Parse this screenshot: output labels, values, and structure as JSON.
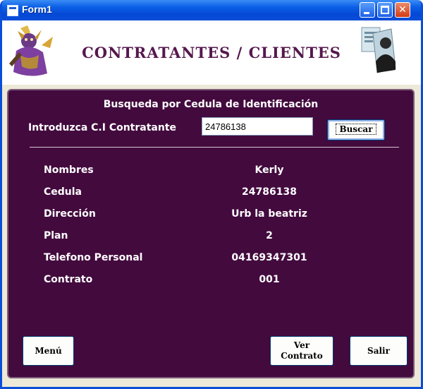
{
  "window": {
    "title": "Form1"
  },
  "header": {
    "title": "CONTRATANTES / CLIENTES"
  },
  "search": {
    "heading": "Busqueda por Cedula de Identificación",
    "label": "Introduzca C.I Contratante",
    "value": "24786138",
    "button": "Buscar"
  },
  "details": [
    {
      "label": "Nombres",
      "value": "Kerly"
    },
    {
      "label": "Cedula",
      "value": "24786138"
    },
    {
      "label": "Dirección",
      "value": "Urb la beatriz"
    },
    {
      "label": "Plan",
      "value": "2"
    },
    {
      "label": "Telefono Personal",
      "value": "04169347301"
    },
    {
      "label": "Contrato",
      "value": "001"
    }
  ],
  "buttons": {
    "menu": "Menú",
    "ver_line1": "Ver",
    "ver_line2": "Contrato",
    "salir": "Salir"
  },
  "colors": {
    "panel": "#430a3e",
    "header_title": "#55184d",
    "titlebar": "#0a4ed8"
  }
}
